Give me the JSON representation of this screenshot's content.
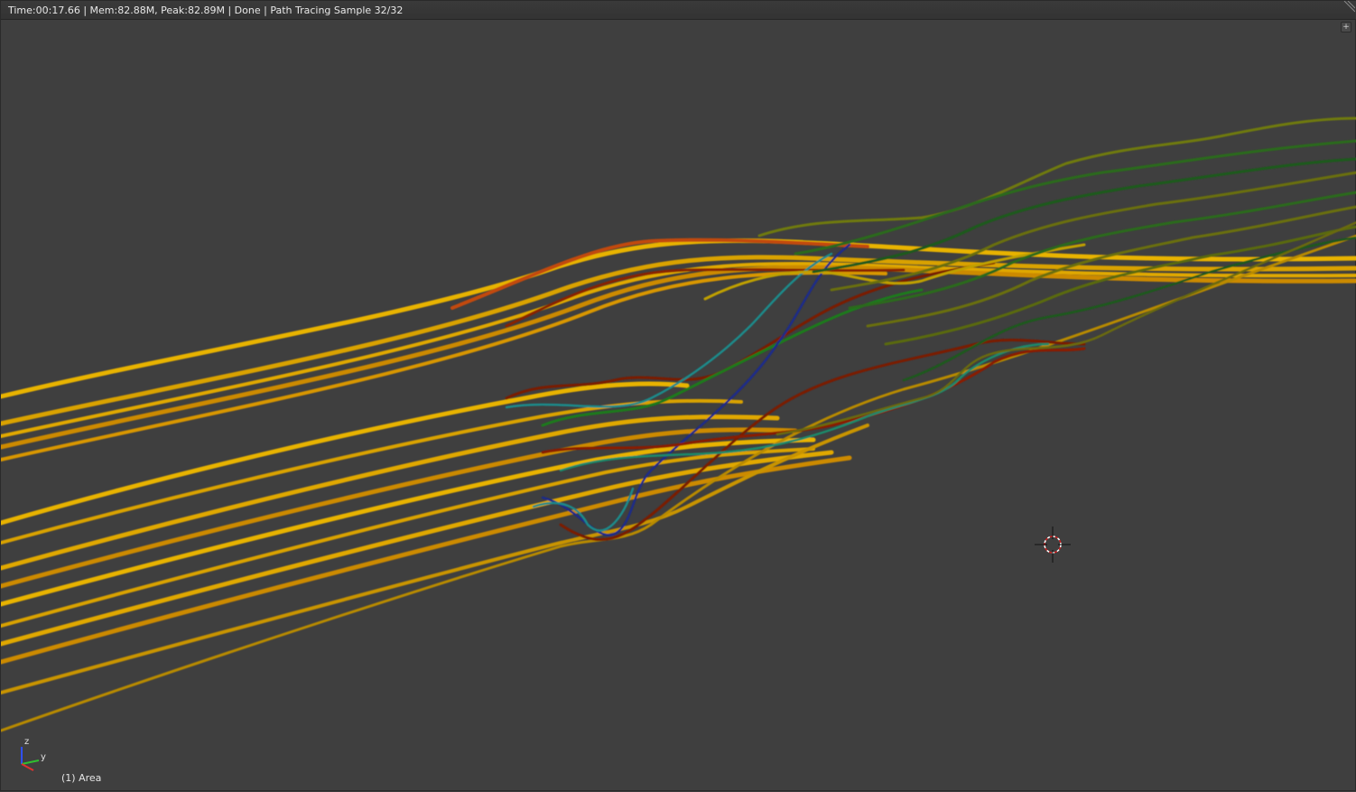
{
  "header": {
    "status_text": "Time:00:17.66 | Mem:82.88M, Peak:82.89M | Done | Path Tracing Sample 32/32"
  },
  "viewport": {
    "object_label": "(1) Area",
    "axes": {
      "z_label": "z",
      "y_label": "y"
    },
    "plus_label": "+"
  },
  "icons": {
    "cursor": "3d-cursor-icon",
    "axes": "axis-gizmo-icon",
    "corner": "area-split-corner-icon"
  },
  "colors": {
    "background": "#3f3f3f",
    "strand_yellow": "#e8b300",
    "strand_orange": "#c96a10",
    "strand_red": "#8a1a00",
    "strand_green": "#1f6a1a",
    "strand_teal": "#1a8a8a",
    "strand_blue": "#1a2a8a"
  }
}
